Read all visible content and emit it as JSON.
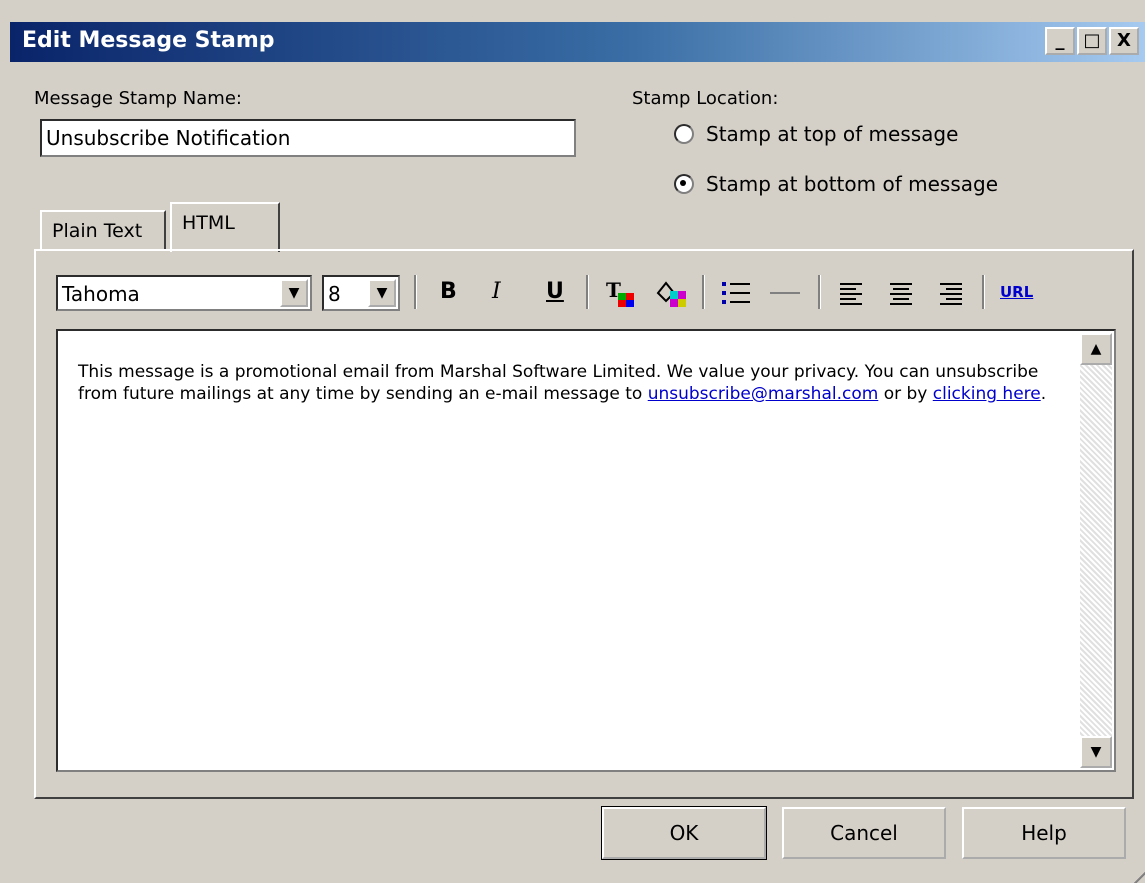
{
  "window": {
    "title": "Edit Message Stamp",
    "min": "_",
    "max": "□",
    "close": "X"
  },
  "name_label": "Message Stamp Name:",
  "name_value": "Unsubscribe Notification",
  "stamp_location": {
    "label": "Stamp Location:",
    "options": [
      {
        "label": "Stamp at top of message",
        "selected": false
      },
      {
        "label": "Stamp at bottom of message",
        "selected": true
      }
    ]
  },
  "tabs": [
    {
      "label": "Plain Text",
      "active": false
    },
    {
      "label": "HTML",
      "active": true
    }
  ],
  "toolbar": {
    "font": "Tahoma",
    "size": "8",
    "bold": "B",
    "italic": "I",
    "underline": "U",
    "url": "URL"
  },
  "editor": {
    "text1": "This message is a promotional email from Marshal Software Limited. We value your privacy. You can unsubscribe from future mailings at any time by sending an e-mail message to ",
    "link1": "unsubscribe@marshal.com",
    "text2": " or by ",
    "link2": "clicking here",
    "text3": "."
  },
  "buttons": {
    "ok": "OK",
    "cancel": "Cancel",
    "help": "Help"
  }
}
